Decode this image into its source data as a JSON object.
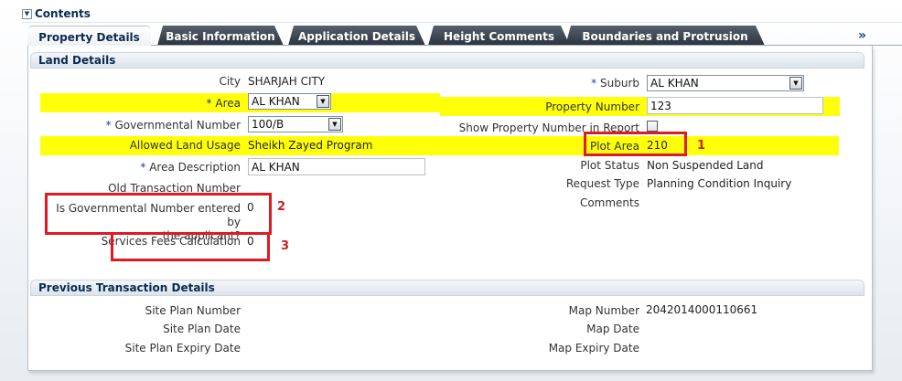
{
  "header": {
    "title": "Contents",
    "toggle_glyph": "▼"
  },
  "tabs": [
    {
      "label": "Property Details",
      "active": true
    },
    {
      "label": "Basic Information",
      "active": false
    },
    {
      "label": "Application Details",
      "active": false
    },
    {
      "label": "Height Comments",
      "active": false
    },
    {
      "label": "Boundaries and Protrusion",
      "active": false
    }
  ],
  "tab_more_glyph": "»",
  "land_details": {
    "title": "Land Details",
    "city": {
      "label": "City",
      "value": "SHARJAH CITY"
    },
    "suburb": {
      "label": "Suburb",
      "value": "AL KHAN"
    },
    "area": {
      "label": "Area",
      "value": "AL KHAN"
    },
    "property_number": {
      "label": "Property Number",
      "value": "123"
    },
    "governmental_number": {
      "label": "Governmental Number",
      "value": "100/B"
    },
    "show_property_number": {
      "label": "Show Property Number in Report",
      "checked": false
    },
    "allowed_land_usage": {
      "label": "Allowed Land Usage",
      "value": "Sheikh Zayed Program"
    },
    "plot_area": {
      "label": "Plot Area",
      "value": "210"
    },
    "area_description": {
      "label": "Area Description",
      "value": "AL KHAN"
    },
    "plot_status": {
      "label": "Plot Status",
      "value": "Non Suspended Land"
    },
    "old_transaction_number": {
      "label": "Old Transaction Number",
      "value": ""
    },
    "request_type": {
      "label": "Request Type",
      "value": "Planning Condition Inquiry"
    },
    "is_governmental": {
      "label_line1": "Is Governmental Number entered by",
      "label_line2": "the applicant?",
      "value": "0"
    },
    "comments": {
      "label": "Comments",
      "value": ""
    },
    "services_fees": {
      "label": "Services Fees Calculation",
      "value": "0"
    }
  },
  "previous_transaction": {
    "title": "Previous Transaction Details",
    "site_plan_number": {
      "label": "Site Plan Number",
      "value": ""
    },
    "map_number": {
      "label": "Map Number",
      "value": "2042014000110661"
    },
    "site_plan_date": {
      "label": "Site Plan Date",
      "value": ""
    },
    "map_date": {
      "label": "Map Date",
      "value": ""
    },
    "site_plan_expiry_date": {
      "label": "Site Plan Expiry Date",
      "value": ""
    },
    "map_expiry_date": {
      "label": "Map Expiry Date",
      "value": ""
    }
  },
  "required_marker": "*",
  "annotations": [
    "1",
    "2",
    "3"
  ],
  "colors": {
    "highlight": "#ffff0a",
    "annotation": "#de1a24",
    "tab_dark": "#2b333c",
    "title_navy": "#0c2a52"
  }
}
